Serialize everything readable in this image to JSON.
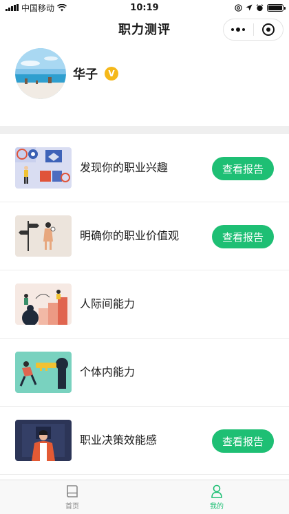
{
  "status_bar": {
    "carrier": "中国移动",
    "time": "10:19",
    "battery_level": 1.0
  },
  "nav": {
    "title": "职力测评"
  },
  "profile": {
    "name": "华子",
    "badge": "V"
  },
  "items": [
    {
      "title": "发现你的职业兴趣",
      "button": "查看报告",
      "thumbnail": "career-interest-illustration"
    },
    {
      "title": "明确你的职业价值观",
      "button": "查看报告",
      "thumbnail": "career-values-illustration"
    },
    {
      "title": "人际间能力",
      "button": null,
      "thumbnail": "interpersonal-illustration"
    },
    {
      "title": "个体内能力",
      "button": null,
      "thumbnail": "intrapersonal-illustration"
    },
    {
      "title": "职业决策效能感",
      "button": "查看报告",
      "thumbnail": "decision-efficacy-illustration"
    }
  ],
  "tabs": [
    {
      "label": "首页",
      "icon": "book-icon",
      "active": false
    },
    {
      "label": "我的",
      "icon": "person-icon",
      "active": true
    }
  ],
  "colors": {
    "accent": "#1ebf74",
    "badge": "#f5b81a"
  }
}
